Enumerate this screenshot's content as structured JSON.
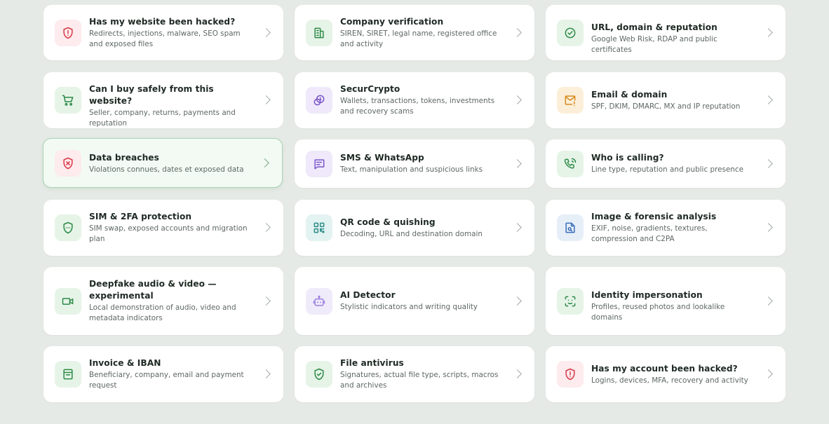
{
  "cards": [
    {
      "title": "Has my website been hacked?",
      "desc": "Redirects, injections, malware, SEO spam and exposed files",
      "icon": "shield-alert-icon",
      "color": "#d93a4a"
    },
    {
      "title": "Company verification",
      "desc": "SIREN, SIRET, legal name, registered office and activity",
      "icon": "building-icon",
      "color": "#2e8a47"
    },
    {
      "title": "URL, domain & reputation",
      "desc": "Google Web Risk, RDAP and public certificates",
      "icon": "badge-check-icon",
      "color": "#2e8a47"
    },
    {
      "title": "Can I buy safely from this website?",
      "desc": "Seller, company, returns, payments and reputation",
      "icon": "cart-icon",
      "color": "#2e8a47"
    },
    {
      "title": "SecurCrypto",
      "desc": "Wallets, transactions, tokens, investments and recovery scams",
      "icon": "coins-icon",
      "color": "#7a55c9"
    },
    {
      "title": "Email & domain",
      "desc": "SPF, DKIM, DMARC, MX and IP reputation",
      "icon": "mail-alert-icon",
      "color": "#d58a1e"
    },
    {
      "title": "Data breaches",
      "desc": "Violations connues, dates et exposed data",
      "icon": "shield-x-icon",
      "color": "#d93a4a"
    },
    {
      "title": "SMS & WhatsApp",
      "desc": "Text, manipulation and suspicious links",
      "icon": "message-icon",
      "color": "#7a55c9"
    },
    {
      "title": "Who is calling?",
      "desc": "Line type, reputation and public presence",
      "icon": "phone-icon",
      "color": "#2e8a47"
    },
    {
      "title": "SIM & 2FA protection",
      "desc": "SIM swap, exposed accounts and migration plan",
      "icon": "shield-dots-icon",
      "color": "#2e8a47"
    },
    {
      "title": "QR code & quishing",
      "desc": "Decoding, URL and destination domain",
      "icon": "qr-code-icon",
      "color": "#2b8c87"
    },
    {
      "title": "Image & forensic analysis",
      "desc": "EXIF, noise, gradients, textures, compression and C2PA",
      "icon": "image-search-icon",
      "color": "#3a6fb8"
    },
    {
      "title": "Deepfake audio & video — experimental",
      "desc": "Local demonstration of audio, video and metadata indicators",
      "icon": "video-icon",
      "color": "#2e8a47"
    },
    {
      "title": "AI Detector",
      "desc": "Stylistic indicators and writing quality",
      "icon": "bot-icon",
      "color": "#9b7fe0"
    },
    {
      "title": "Identity impersonation",
      "desc": "Profiles, reused photos and lookalike domains",
      "icon": "face-scan-icon",
      "color": "#2e8a47"
    },
    {
      "title": "Invoice & IBAN",
      "desc": "Beneficiary, company, email and payment request",
      "icon": "receipt-icon",
      "color": "#2e8a47"
    },
    {
      "title": "File antivirus",
      "desc": "Signatures, actual file type, scripts, macros and archives",
      "icon": "shield-check-icon",
      "color": "#2e8a47"
    },
    {
      "title": "Has my account been hacked?",
      "desc": "Logins, devices, MFA, recovery and activity",
      "icon": "shield-alert-icon",
      "color": "#d93a4a"
    }
  ]
}
